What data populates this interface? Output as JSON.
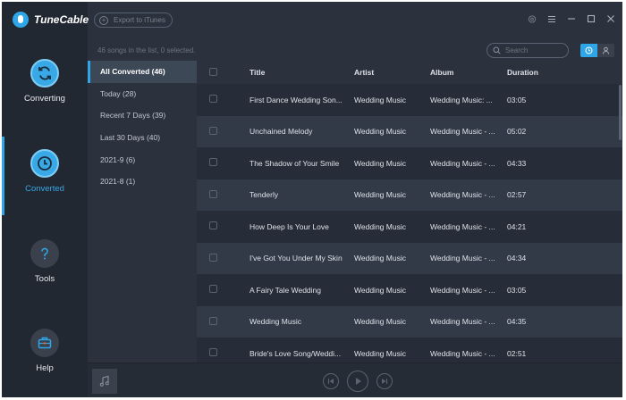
{
  "app": {
    "name": "TuneCable"
  },
  "toolbar": {
    "export_label": "Export to iTunes"
  },
  "nav": [
    {
      "label": "Converting",
      "icon": "refresh-icon"
    },
    {
      "label": "Converted",
      "icon": "clock-icon"
    },
    {
      "label": "Tools",
      "icon": "question-icon"
    },
    {
      "label": "Help",
      "icon": "toolbox-icon"
    }
  ],
  "status": {
    "count_text": "46 songs in the list, 0 selected."
  },
  "search": {
    "placeholder": "Search"
  },
  "filters": [
    {
      "label": "All Converted (46)"
    },
    {
      "label": "Today (28)"
    },
    {
      "label": "Recent 7 Days (39)"
    },
    {
      "label": "Last 30 Days (40)"
    },
    {
      "label": "2021-9 (6)"
    },
    {
      "label": "2021-8 (1)"
    }
  ],
  "table": {
    "columns": [
      "Title",
      "Artist",
      "Album",
      "Duration"
    ],
    "rows": [
      {
        "title": "First Dance Wedding Son...",
        "artist": "Wedding Music",
        "album": "Wedding Music: ...",
        "duration": "03:05"
      },
      {
        "title": "Unchained Melody",
        "artist": "Wedding Music",
        "album": "Wedding Music - ...",
        "duration": "05:02"
      },
      {
        "title": "The Shadow of Your Smile",
        "artist": "Wedding Music",
        "album": "Wedding Music - ...",
        "duration": "04:33"
      },
      {
        "title": "Tenderly",
        "artist": "Wedding Music",
        "album": "Wedding Music - ...",
        "duration": "02:57"
      },
      {
        "title": "How Deep Is Your Love",
        "artist": "Wedding Music",
        "album": "Wedding Music - ...",
        "duration": "04:21"
      },
      {
        "title": "I've Got You Under My Skin",
        "artist": "Wedding Music",
        "album": "Wedding Music - ...",
        "duration": "04:34"
      },
      {
        "title": "A Fairy Tale Wedding",
        "artist": "Wedding Music",
        "album": "Wedding Music - ...",
        "duration": "03:05"
      },
      {
        "title": "Wedding Music",
        "artist": "Wedding Music",
        "album": "Wedding Music - ...",
        "duration": "04:35"
      },
      {
        "title": "Bride's Love Song/Weddi...",
        "artist": "Wedding Music",
        "album": "Wedding Music - ...",
        "duration": "02:51"
      }
    ]
  },
  "colors": {
    "accent": "#2ea6e8",
    "background": "#2b323e",
    "sidebar": "#222831"
  }
}
